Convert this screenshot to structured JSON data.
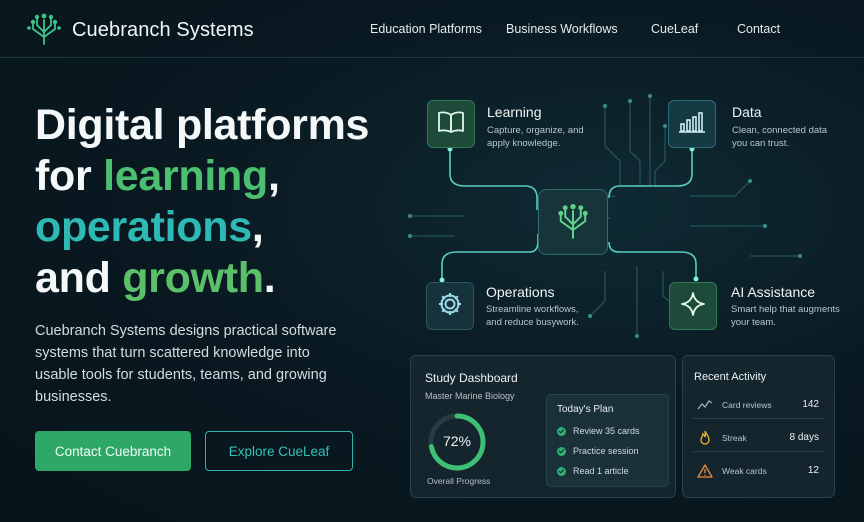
{
  "brand": {
    "name": "Cuebranch Systems"
  },
  "nav": {
    "items": [
      "Education Platforms",
      "Business Workflows",
      "CueLeaf",
      "Contact"
    ]
  },
  "hero": {
    "line1": "Digital platforms",
    "line2_prefix": "for ",
    "line2_highlight": "learning",
    "line2_suffix": ",",
    "line3_highlight": "operations",
    "line3_suffix": ",",
    "line4_prefix": "and ",
    "line4_highlight": "growth",
    "line4_suffix": ".",
    "description": "Cuebranch Systems designs practical software systems that turn scattered knowledge into usable tools for students, teams, and growing businesses.",
    "primary_button": "Contact Cuebranch",
    "secondary_button": "Explore CueLeaf"
  },
  "diagram": {
    "learning": {
      "title": "Learning",
      "desc": "Capture, organize, and apply knowledge."
    },
    "data": {
      "title": "Data",
      "desc": "Clean, connected data you can trust."
    },
    "operations": {
      "title": "Operations",
      "desc": "Streamline workflows, and reduce busywork."
    },
    "ai": {
      "title": "AI Assistance",
      "desc": "Smart help that augments your team."
    }
  },
  "study_dashboard": {
    "title": "Study Dashboard",
    "subtitle": "Master Marine Biology",
    "progress_value": 72,
    "progress_text": "72%",
    "progress_label": "Overall Progress",
    "plan_title": "Today's Plan",
    "plan_items": [
      "Review 35 cards",
      "Practice session",
      "Read 1 article"
    ]
  },
  "recent_activity": {
    "title": "Recent Activity",
    "rows": [
      {
        "label": "Card reviews",
        "value": "142",
        "icon": "trend-icon"
      },
      {
        "label": "Streak",
        "value": "8 days",
        "icon": "flame-icon"
      },
      {
        "label": "Weak cards",
        "value": "12",
        "icon": "warning-icon"
      }
    ]
  },
  "colors": {
    "accent_green": "#4cbf70",
    "accent_teal": "#2fb9b5",
    "button_green": "#2ea866",
    "background": "#0a1a22"
  }
}
